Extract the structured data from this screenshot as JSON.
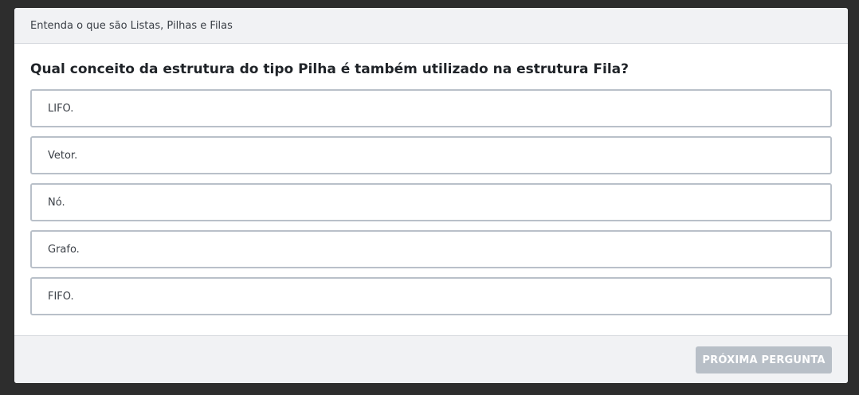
{
  "header": {
    "title": "Entenda o que são Listas, Pilhas e Filas"
  },
  "question": {
    "text": "Qual conceito da estrutura do tipo Pilha é também utilizado na estrutura Fila?"
  },
  "options": [
    {
      "label": "LIFO."
    },
    {
      "label": "Vetor."
    },
    {
      "label": "Nó."
    },
    {
      "label": "Grafo."
    },
    {
      "label": "FIFO."
    }
  ],
  "footer": {
    "next_label": "PRÓXIMA PERGUNTA"
  },
  "colors": {
    "background": "#2d2d2d",
    "header_bg": "#f1f2f4",
    "option_border": "#b9c0c9",
    "button_disabled": "#b8bfc7"
  }
}
